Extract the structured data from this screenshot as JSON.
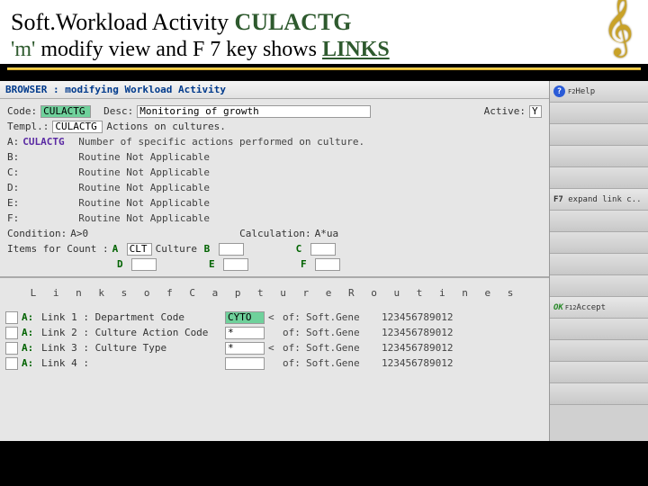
{
  "title": {
    "pre": "Soft.Workload Activity ",
    "cul": "CULACTG",
    "m": "'m'",
    "mid": " modify view and F 7 key shows ",
    "links": "LINKS"
  },
  "browser_label": "BROWSER :  modifying Workload Activity",
  "labels": {
    "code": "Code:",
    "desc": "Desc:",
    "active": "Active:",
    "templ": "Templ.:",
    "condition": "Condition:",
    "calculation": "Calculation:",
    "items_for_count": "Items for Count  :"
  },
  "fields": {
    "code": "CULACTG",
    "desc": "Monitoring of growth",
    "active": "Y",
    "templ": "CULACTG",
    "templ_desc": "Actions on cultures.",
    "condition": "A>0",
    "calculation": "A*ua"
  },
  "routines": [
    {
      "letter": "A:",
      "code": "CULACTG",
      "desc": "Number of specific actions performed on culture."
    },
    {
      "letter": "B:",
      "code": "",
      "desc": "Routine Not Applicable"
    },
    {
      "letter": "C:",
      "code": "",
      "desc": "Routine Not Applicable"
    },
    {
      "letter": "D:",
      "code": "",
      "desc": "Routine Not Applicable"
    },
    {
      "letter": "E:",
      "code": "",
      "desc": "Routine Not Applicable"
    },
    {
      "letter": "F:",
      "code": "",
      "desc": "Routine Not Applicable"
    }
  ],
  "counts": [
    {
      "letter": "A",
      "val": "CLT",
      "sub": "Culture"
    },
    {
      "letter": "B",
      "val": "",
      "sub": ""
    },
    {
      "letter": "C",
      "val": "",
      "sub": ""
    },
    {
      "letter": "D",
      "val": "",
      "sub": ""
    },
    {
      "letter": "E",
      "val": "",
      "sub": ""
    },
    {
      "letter": "F",
      "val": "",
      "sub": ""
    }
  ],
  "links_header": "L i n k s   o f   C a p t u r e   R o u t i n e s",
  "links": [
    {
      "a": "A:",
      "label": "Link 1 : Department Code",
      "val": "CYTO",
      "hl": true,
      "lt": "<",
      "of": "of:",
      "gene": "Soft.Gene",
      "num": "123456789012"
    },
    {
      "a": "A:",
      "label": "Link 2 : Culture Action Code",
      "val": "*",
      "hl": false,
      "lt": "",
      "of": "of:",
      "gene": "Soft.Gene",
      "num": "123456789012"
    },
    {
      "a": "A:",
      "label": "Link 3 : Culture Type",
      "val": "*",
      "hl": false,
      "lt": "<",
      "of": "of:",
      "gene": "Soft.Gene",
      "num": "123456789012"
    },
    {
      "a": "A:",
      "label": "Link 4 :",
      "val": "",
      "hl": false,
      "lt": "",
      "of": "of:",
      "gene": "Soft.Gene",
      "num": "123456789012"
    }
  ],
  "side": {
    "help": "Help",
    "help_key": "F2",
    "expand": "expand link c..",
    "expand_key": "F7",
    "accept": "Accept",
    "accept_key": "F12",
    "ok": "OK"
  }
}
